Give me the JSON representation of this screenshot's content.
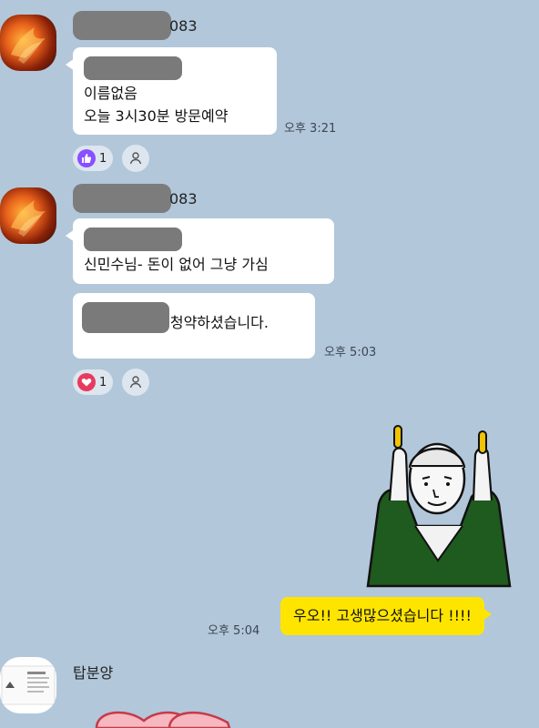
{
  "messages": [
    {
      "sender_suffix": "083",
      "lines": [
        "이름없음",
        "오늘 3시30분 방문예약"
      ],
      "time": "오후 3:21",
      "reaction_count": "1"
    },
    {
      "sender_suffix": "083",
      "bubble1": "신민수님- 돈이 없어 그냥 가심",
      "bubble2_tail": "- 청약하셨습니다.",
      "time": "오후 5:03",
      "reaction_count": "1"
    }
  ],
  "sticker": {
    "name": "thumbs-up-man-sticker"
  },
  "my_message": {
    "text": "우오!! 고생많으셨습니다 !!!!",
    "time": "오후 5:04"
  },
  "last_sender": {
    "name": "탑분양"
  },
  "colors": {
    "background": "#b2c7da",
    "my_bubble": "#fee500",
    "bubble": "#ffffff",
    "thumbs_reaction": "#8a4fff",
    "heart_reaction": "#e83a5f"
  }
}
